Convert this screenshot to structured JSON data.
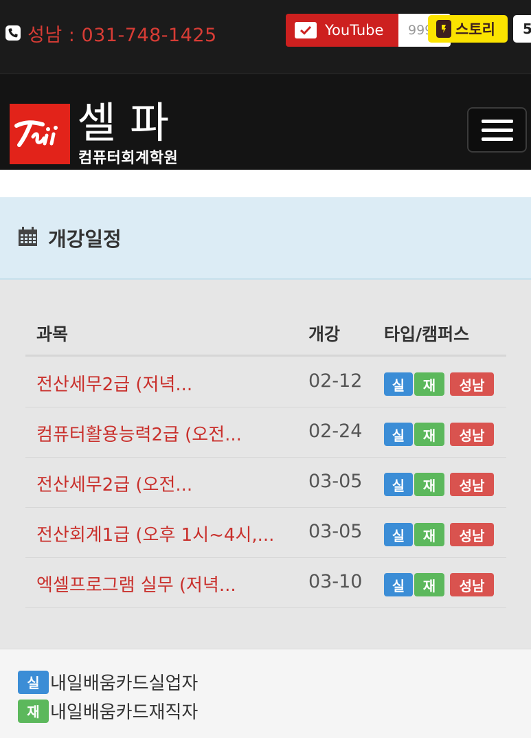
{
  "topbar": {
    "phone_text": "성남 : 031-748-1425",
    "youtube_label": "YouTube",
    "youtube_count": "999",
    "story_label": "스토리",
    "story_count": "5"
  },
  "header": {
    "logo_title": "셀파",
    "logo_sub": "컴퓨터회계학원"
  },
  "schedule": {
    "title": "개강일정",
    "columns": [
      "과목",
      "개강",
      "타입/캠퍼스"
    ],
    "rows": [
      {
        "course": "전산세무2급 (저녁...",
        "date": "02-12",
        "type1": "실",
        "type2": "재",
        "campus": "성남"
      },
      {
        "course": "컴퓨터활용능력2급 (오전...",
        "date": "02-24",
        "type1": "실",
        "type2": "재",
        "campus": "성남"
      },
      {
        "course": "전산세무2급 (오전...",
        "date": "03-05",
        "type1": "실",
        "type2": "재",
        "campus": "성남"
      },
      {
        "course": "전산회계1급 (오후 1시~4시,...",
        "date": "03-05",
        "type1": "실",
        "type2": "재",
        "campus": "성남"
      },
      {
        "course": "엑셀프로그램 실무 (저녁...",
        "date": "03-10",
        "type1": "실",
        "type2": "재",
        "campus": "성남"
      }
    ]
  },
  "legend": [
    {
      "badge": "실",
      "text": "내일배움카드실업자",
      "color": "#3b8dd6"
    },
    {
      "badge": "재",
      "text": "내일배움카드재직자",
      "color": "#5cb85c"
    }
  ],
  "colors": {
    "accent_red": "#d73c35",
    "youtube_red": "#cd201f",
    "kakao_yellow": "#fbe300",
    "badge_blue": "#3b8dd6",
    "badge_green": "#5cb85c",
    "badge_red": "#d9534f"
  },
  "icons": [
    "phone-icon",
    "check-icon",
    "kakao-story-icon",
    "menu-icon",
    "calendar-icon"
  ]
}
